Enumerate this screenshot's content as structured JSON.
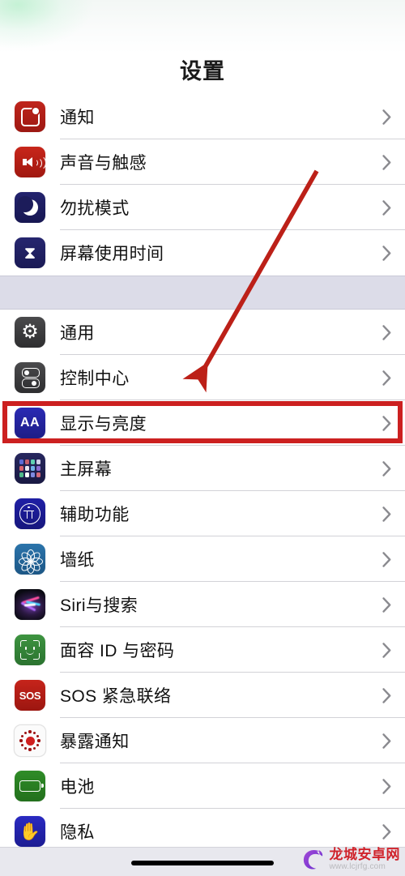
{
  "header": {
    "title": "设置"
  },
  "groups": [
    {
      "name": "group-1",
      "rows": [
        {
          "label": "通知",
          "icon": "notifications-icon",
          "icon_class": "ic-notif"
        },
        {
          "label": "声音与触感",
          "icon": "sound-haptics-icon",
          "icon_class": "ic-sound"
        },
        {
          "label": "勿扰模式",
          "icon": "do-not-disturb-icon",
          "icon_class": "ic-dnd"
        },
        {
          "label": "屏幕使用时间",
          "icon": "screen-time-icon",
          "icon_class": "ic-screen"
        }
      ]
    },
    {
      "name": "group-2",
      "rows": [
        {
          "label": "通用",
          "icon": "general-gear-icon",
          "icon_class": "ic-general"
        },
        {
          "label": "控制中心",
          "icon": "control-center-icon",
          "icon_class": "ic-cc"
        },
        {
          "label": "显示与亮度",
          "icon": "display-brightness-icon",
          "icon_class": "ic-display"
        },
        {
          "label": "主屏幕",
          "icon": "home-screen-icon",
          "icon_class": "ic-home"
        },
        {
          "label": "辅助功能",
          "icon": "accessibility-icon",
          "icon_class": "ic-access"
        },
        {
          "label": "墙纸",
          "icon": "wallpaper-icon",
          "icon_class": "ic-wall"
        },
        {
          "label": "Siri与搜索",
          "icon": "siri-search-icon",
          "icon_class": "ic-siri"
        },
        {
          "label": "面容 ID 与密码",
          "icon": "face-id-passcode-icon",
          "icon_class": "ic-faceid"
        },
        {
          "label": "SOS 紧急联络",
          "icon": "emergency-sos-icon",
          "icon_class": "ic-sos"
        },
        {
          "label": "暴露通知",
          "icon": "exposure-notifications-icon",
          "icon_class": "ic-expose"
        },
        {
          "label": "电池",
          "icon": "battery-icon",
          "icon_class": "ic-battery"
        },
        {
          "label": "隐私",
          "icon": "privacy-hand-icon",
          "icon_class": "ic-privacy"
        }
      ]
    }
  ],
  "annotations": {
    "highlight_color": "#cc2020",
    "highlight_target": "显示与亮度",
    "arrow_color": "#bc2018"
  },
  "watermark": {
    "name": "龙城安卓网",
    "url": "www.lcjrfg.com"
  },
  "icons": {
    "chevron": "chevron-right-icon",
    "sos_text": "SOS"
  }
}
